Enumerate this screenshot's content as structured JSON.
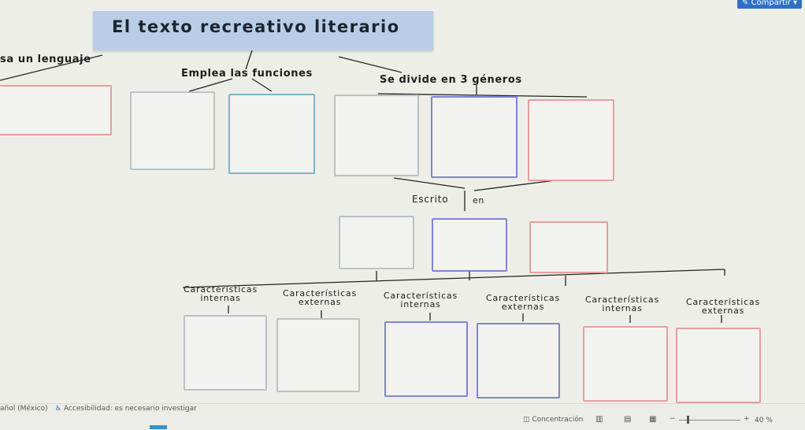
{
  "document": {
    "title": "El texto recreativo literario",
    "share_label": "Compartir",
    "top_labels": {
      "language": "sa un lenguaje",
      "functions": "Emplea las funciones",
      "genres": "Se divide en 3 géneros"
    },
    "written_label": "Escrito",
    "written_suffix": "en",
    "characteristics": [
      {
        "line1": "Características",
        "line2": "internas"
      },
      {
        "line1": "Características",
        "line2": "externas"
      },
      {
        "line1": "Características",
        "line2": "internas"
      },
      {
        "line1": "Características",
        "line2": "externas"
      },
      {
        "line1": "Características",
        "line2": "internas"
      },
      {
        "line1": "Características",
        "line2": "externas"
      }
    ]
  },
  "status_bar": {
    "language": "añol (México)",
    "accessibility": "Accesibilidad: es necesario investigar",
    "focus": "Concentración",
    "zoom": "40 %"
  },
  "colors": {
    "title_bg": "#b9cde6",
    "box_gray": "#b7c3c8",
    "box_teal": "#7fb4c4",
    "box_blue": "#7d86d1",
    "box_red": "#e4a09e"
  }
}
